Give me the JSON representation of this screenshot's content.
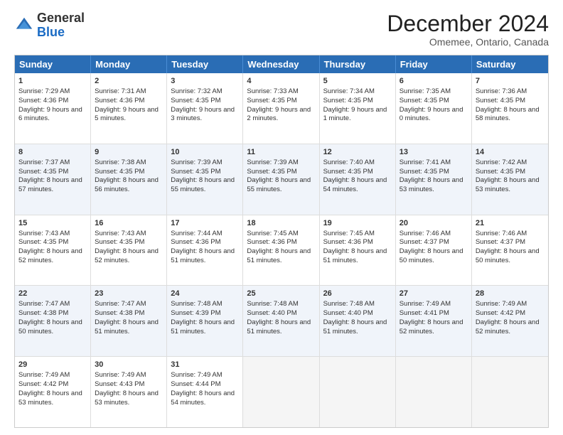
{
  "header": {
    "logo_general": "General",
    "logo_blue": "Blue",
    "title": "December 2024",
    "location": "Omemee, Ontario, Canada"
  },
  "days_of_week": [
    "Sunday",
    "Monday",
    "Tuesday",
    "Wednesday",
    "Thursday",
    "Friday",
    "Saturday"
  ],
  "weeks": [
    [
      {
        "day": "1",
        "sunrise": "Sunrise: 7:29 AM",
        "sunset": "Sunset: 4:36 PM",
        "daylight": "Daylight: 9 hours and 6 minutes."
      },
      {
        "day": "2",
        "sunrise": "Sunrise: 7:31 AM",
        "sunset": "Sunset: 4:36 PM",
        "daylight": "Daylight: 9 hours and 5 minutes."
      },
      {
        "day": "3",
        "sunrise": "Sunrise: 7:32 AM",
        "sunset": "Sunset: 4:35 PM",
        "daylight": "Daylight: 9 hours and 3 minutes."
      },
      {
        "day": "4",
        "sunrise": "Sunrise: 7:33 AM",
        "sunset": "Sunset: 4:35 PM",
        "daylight": "Daylight: 9 hours and 2 minutes."
      },
      {
        "day": "5",
        "sunrise": "Sunrise: 7:34 AM",
        "sunset": "Sunset: 4:35 PM",
        "daylight": "Daylight: 9 hours and 1 minute."
      },
      {
        "day": "6",
        "sunrise": "Sunrise: 7:35 AM",
        "sunset": "Sunset: 4:35 PM",
        "daylight": "Daylight: 9 hours and 0 minutes."
      },
      {
        "day": "7",
        "sunrise": "Sunrise: 7:36 AM",
        "sunset": "Sunset: 4:35 PM",
        "daylight": "Daylight: 8 hours and 58 minutes."
      }
    ],
    [
      {
        "day": "8",
        "sunrise": "Sunrise: 7:37 AM",
        "sunset": "Sunset: 4:35 PM",
        "daylight": "Daylight: 8 hours and 57 minutes."
      },
      {
        "day": "9",
        "sunrise": "Sunrise: 7:38 AM",
        "sunset": "Sunset: 4:35 PM",
        "daylight": "Daylight: 8 hours and 56 minutes."
      },
      {
        "day": "10",
        "sunrise": "Sunrise: 7:39 AM",
        "sunset": "Sunset: 4:35 PM",
        "daylight": "Daylight: 8 hours and 55 minutes."
      },
      {
        "day": "11",
        "sunrise": "Sunrise: 7:39 AM",
        "sunset": "Sunset: 4:35 PM",
        "daylight": "Daylight: 8 hours and 55 minutes."
      },
      {
        "day": "12",
        "sunrise": "Sunrise: 7:40 AM",
        "sunset": "Sunset: 4:35 PM",
        "daylight": "Daylight: 8 hours and 54 minutes."
      },
      {
        "day": "13",
        "sunrise": "Sunrise: 7:41 AM",
        "sunset": "Sunset: 4:35 PM",
        "daylight": "Daylight: 8 hours and 53 minutes."
      },
      {
        "day": "14",
        "sunrise": "Sunrise: 7:42 AM",
        "sunset": "Sunset: 4:35 PM",
        "daylight": "Daylight: 8 hours and 53 minutes."
      }
    ],
    [
      {
        "day": "15",
        "sunrise": "Sunrise: 7:43 AM",
        "sunset": "Sunset: 4:35 PM",
        "daylight": "Daylight: 8 hours and 52 minutes."
      },
      {
        "day": "16",
        "sunrise": "Sunrise: 7:43 AM",
        "sunset": "Sunset: 4:35 PM",
        "daylight": "Daylight: 8 hours and 52 minutes."
      },
      {
        "day": "17",
        "sunrise": "Sunrise: 7:44 AM",
        "sunset": "Sunset: 4:36 PM",
        "daylight": "Daylight: 8 hours and 51 minutes."
      },
      {
        "day": "18",
        "sunrise": "Sunrise: 7:45 AM",
        "sunset": "Sunset: 4:36 PM",
        "daylight": "Daylight: 8 hours and 51 minutes."
      },
      {
        "day": "19",
        "sunrise": "Sunrise: 7:45 AM",
        "sunset": "Sunset: 4:36 PM",
        "daylight": "Daylight: 8 hours and 51 minutes."
      },
      {
        "day": "20",
        "sunrise": "Sunrise: 7:46 AM",
        "sunset": "Sunset: 4:37 PM",
        "daylight": "Daylight: 8 hours and 50 minutes."
      },
      {
        "day": "21",
        "sunrise": "Sunrise: 7:46 AM",
        "sunset": "Sunset: 4:37 PM",
        "daylight": "Daylight: 8 hours and 50 minutes."
      }
    ],
    [
      {
        "day": "22",
        "sunrise": "Sunrise: 7:47 AM",
        "sunset": "Sunset: 4:38 PM",
        "daylight": "Daylight: 8 hours and 50 minutes."
      },
      {
        "day": "23",
        "sunrise": "Sunrise: 7:47 AM",
        "sunset": "Sunset: 4:38 PM",
        "daylight": "Daylight: 8 hours and 51 minutes."
      },
      {
        "day": "24",
        "sunrise": "Sunrise: 7:48 AM",
        "sunset": "Sunset: 4:39 PM",
        "daylight": "Daylight: 8 hours and 51 minutes."
      },
      {
        "day": "25",
        "sunrise": "Sunrise: 7:48 AM",
        "sunset": "Sunset: 4:40 PM",
        "daylight": "Daylight: 8 hours and 51 minutes."
      },
      {
        "day": "26",
        "sunrise": "Sunrise: 7:48 AM",
        "sunset": "Sunset: 4:40 PM",
        "daylight": "Daylight: 8 hours and 51 minutes."
      },
      {
        "day": "27",
        "sunrise": "Sunrise: 7:49 AM",
        "sunset": "Sunset: 4:41 PM",
        "daylight": "Daylight: 8 hours and 52 minutes."
      },
      {
        "day": "28",
        "sunrise": "Sunrise: 7:49 AM",
        "sunset": "Sunset: 4:42 PM",
        "daylight": "Daylight: 8 hours and 52 minutes."
      }
    ],
    [
      {
        "day": "29",
        "sunrise": "Sunrise: 7:49 AM",
        "sunset": "Sunset: 4:42 PM",
        "daylight": "Daylight: 8 hours and 53 minutes."
      },
      {
        "day": "30",
        "sunrise": "Sunrise: 7:49 AM",
        "sunset": "Sunset: 4:43 PM",
        "daylight": "Daylight: 8 hours and 53 minutes."
      },
      {
        "day": "31",
        "sunrise": "Sunrise: 7:49 AM",
        "sunset": "Sunset: 4:44 PM",
        "daylight": "Daylight: 8 hours and 54 minutes."
      },
      {
        "day": "",
        "sunrise": "",
        "sunset": "",
        "daylight": ""
      },
      {
        "day": "",
        "sunrise": "",
        "sunset": "",
        "daylight": ""
      },
      {
        "day": "",
        "sunrise": "",
        "sunset": "",
        "daylight": ""
      },
      {
        "day": "",
        "sunrise": "",
        "sunset": "",
        "daylight": ""
      }
    ]
  ]
}
